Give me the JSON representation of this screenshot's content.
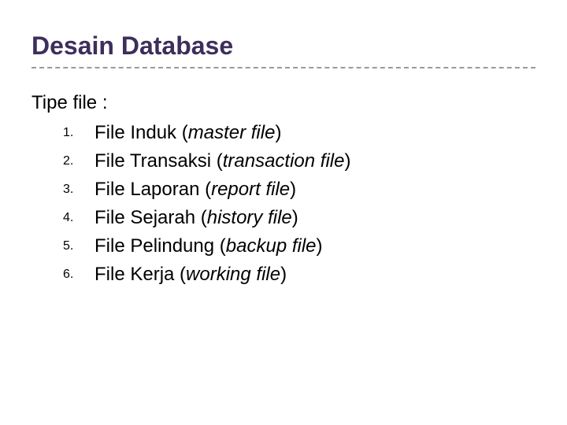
{
  "title": "Desain Database",
  "intro": "Tipe file :",
  "items": [
    {
      "num": "1.",
      "name": "File Induk",
      "english": "master file"
    },
    {
      "num": "2.",
      "name": "File Transaksi",
      "english": "transaction file"
    },
    {
      "num": "3.",
      "name": "File Laporan",
      "english": "report file"
    },
    {
      "num": "4.",
      "name": "File Sejarah",
      "english": "history file"
    },
    {
      "num": "5.",
      "name": "File Pelindung",
      "english": "backup file"
    },
    {
      "num": "6.",
      "name": "File Kerja",
      "english": "working file"
    }
  ]
}
